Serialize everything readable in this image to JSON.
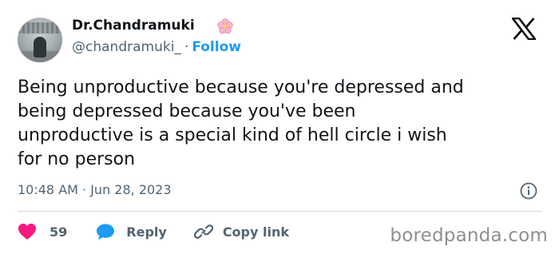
{
  "author": {
    "display_name": "Dr.Chandramuki",
    "name_emoji": "cherry-blossom-icon",
    "handle": "@chandramuki_",
    "separator": "·",
    "follow_label": "Follow"
  },
  "platform_logo": "x-logo-icon",
  "tweet": {
    "text": "Being unproductive because you're depressed and\nbeing depressed because you've been\nunproductive is a special kind of hell circle i wish\nfor no person",
    "timestamp": "10:48 AM · Jun 28, 2023"
  },
  "actions": {
    "like_count": "59",
    "reply_label": "Reply",
    "copy_link_label": "Copy link"
  },
  "watermark": "boredpanda.com",
  "colors": {
    "accent": "#1d9bf0",
    "like": "#f91880",
    "text": "#0f1419",
    "muted": "#536471"
  }
}
